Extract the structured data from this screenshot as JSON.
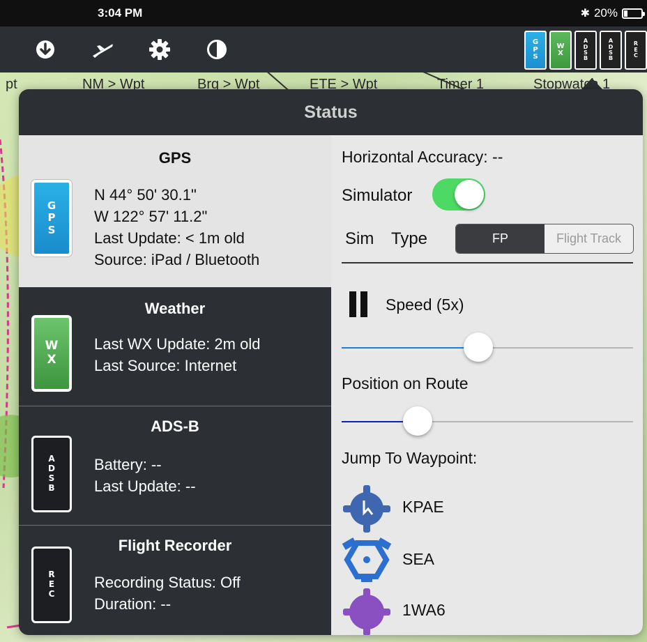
{
  "status_bar": {
    "time": "3:04 PM",
    "bluetooth": "✱",
    "battery": "20%"
  },
  "toolbar": {
    "icons": [
      "download-icon",
      "airplane-icon",
      "gear-icon",
      "contrast-icon"
    ],
    "badges": [
      {
        "name": "gps",
        "text": "G\nP\nS"
      },
      {
        "name": "wx",
        "text": "W\nX"
      },
      {
        "name": "adsb-1",
        "text": "A\nD\nS\nB"
      },
      {
        "name": "adsb-2",
        "text": "A\nD\nS\nB"
      },
      {
        "name": "rec",
        "text": "R\nE\nC"
      }
    ]
  },
  "instrument_strip": {
    "pt": "pt",
    "nm_wpt": "NM > Wpt",
    "brg_wpt": "Brg > Wpt",
    "ete_wpt": "ETE > Wpt",
    "timer": "Timer 1",
    "stopwatch": "Stopwatch 1"
  },
  "popover": {
    "title": "Status",
    "gps": {
      "title": "GPS",
      "badge": "G\nP\nS",
      "lat": "N 44° 50' 30.1\"",
      "lon": "W 122° 57' 11.2\"",
      "last_update": "Last Update: < 1m old",
      "source": "Source: iPad / Bluetooth"
    },
    "weather": {
      "title": "Weather",
      "badge": "W\nX",
      "last_update": "Last WX Update: 2m old",
      "last_source": "Last Source: Internet"
    },
    "adsb": {
      "title": "ADS-B",
      "badge": "A\nD\nS\nB",
      "battery": "Battery: --",
      "last_update": "Last Update: --"
    },
    "recorder": {
      "title": "Flight Recorder",
      "badge": "R\nE\nC",
      "status": "Recording Status: Off",
      "duration": "Duration: --"
    },
    "right": {
      "horizontal_accuracy": "Horizontal Accuracy: --",
      "simulator_label": "Simulator",
      "simulator_on": true,
      "sim_label": "Sim",
      "type_label": "Type",
      "sim_type_options": [
        "FP",
        "Flight Track"
      ],
      "sim_type_selected": "FP",
      "speed_label": "Speed (5x)",
      "speed_fraction": 0.47,
      "position_label": "Position on Route",
      "position_fraction": 0.26,
      "jump_label": "Jump To Waypoint:",
      "waypoints": [
        {
          "id": "KPAE",
          "icon": "towered-airport-icon",
          "color": "#3f67b0"
        },
        {
          "id": "SEA",
          "icon": "vor-icon",
          "color": "#2d6fd0"
        },
        {
          "id": "1WA6",
          "icon": "private-airport-icon",
          "color": "#8a4fc0"
        }
      ]
    }
  },
  "colors": {
    "accent_blue": "#1f7ae0",
    "route_blue": "#0a1fb8",
    "switch_green": "#4cd964"
  }
}
